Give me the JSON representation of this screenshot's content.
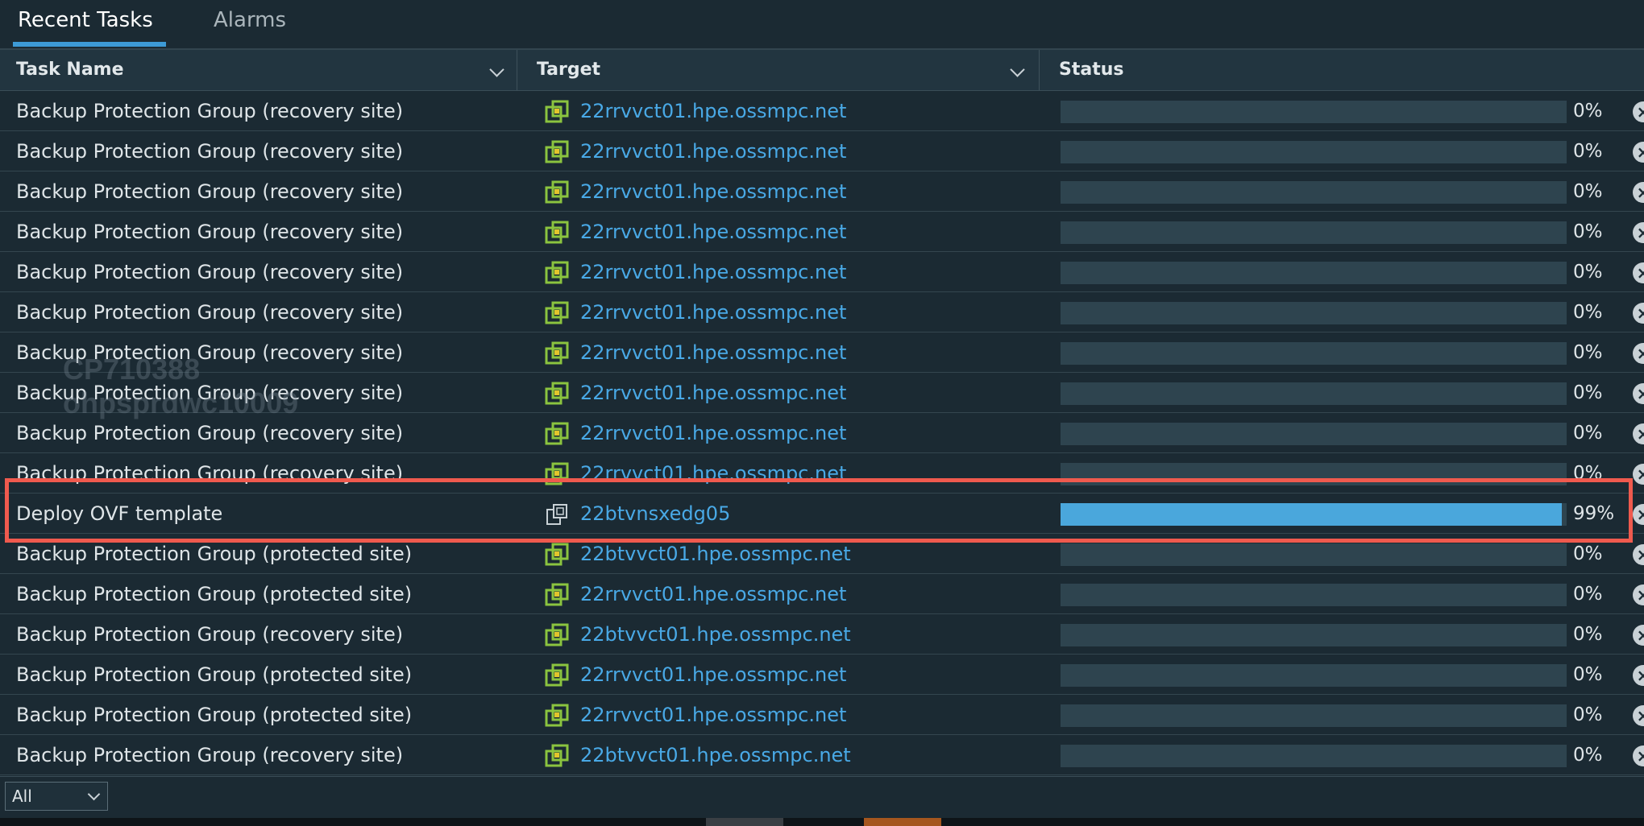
{
  "tabs": [
    {
      "label": "Recent Tasks",
      "active": true
    },
    {
      "label": "Alarms",
      "active": false
    }
  ],
  "columns": {
    "task": "Task Name",
    "target": "Target",
    "status": "Status"
  },
  "rows": [
    {
      "task": "Backup Protection Group (recovery site)",
      "target": "22rrvvct01.hpe.ossmpc.net",
      "icon": "vcenter-icon",
      "progress": 0,
      "percent": "0%"
    },
    {
      "task": "Backup Protection Group (recovery site)",
      "target": "22rrvvct01.hpe.ossmpc.net",
      "icon": "vcenter-icon",
      "progress": 0,
      "percent": "0%"
    },
    {
      "task": "Backup Protection Group (recovery site)",
      "target": "22rrvvct01.hpe.ossmpc.net",
      "icon": "vcenter-icon",
      "progress": 0,
      "percent": "0%"
    },
    {
      "task": "Backup Protection Group (recovery site)",
      "target": "22rrvvct01.hpe.ossmpc.net",
      "icon": "vcenter-icon",
      "progress": 0,
      "percent": "0%"
    },
    {
      "task": "Backup Protection Group (recovery site)",
      "target": "22rrvvct01.hpe.ossmpc.net",
      "icon": "vcenter-icon",
      "progress": 0,
      "percent": "0%"
    },
    {
      "task": "Backup Protection Group (recovery site)",
      "target": "22rrvvct01.hpe.ossmpc.net",
      "icon": "vcenter-icon",
      "progress": 0,
      "percent": "0%"
    },
    {
      "task": "Backup Protection Group (recovery site)",
      "target": "22rrvvct01.hpe.ossmpc.net",
      "icon": "vcenter-icon",
      "progress": 0,
      "percent": "0%"
    },
    {
      "task": "Backup Protection Group (recovery site)",
      "target": "22rrvvct01.hpe.ossmpc.net",
      "icon": "vcenter-icon",
      "progress": 0,
      "percent": "0%"
    },
    {
      "task": "Backup Protection Group (recovery site)",
      "target": "22rrvvct01.hpe.ossmpc.net",
      "icon": "vcenter-icon",
      "progress": 0,
      "percent": "0%"
    },
    {
      "task": "Backup Protection Group (recovery site)",
      "target": "22rrvvct01.hpe.ossmpc.net",
      "icon": "vcenter-icon",
      "progress": 0,
      "percent": "0%"
    },
    {
      "task": "Deploy OVF template",
      "target": "22btvnsxedg05",
      "icon": "vm-icon",
      "progress": 0.99,
      "percent": "99%"
    },
    {
      "task": "Backup Protection Group (protected site)",
      "target": "22btvvct01.hpe.ossmpc.net",
      "icon": "vcenter-icon",
      "progress": 0,
      "percent": "0%"
    },
    {
      "task": "Backup Protection Group (protected site)",
      "target": "22rrvvct01.hpe.ossmpc.net",
      "icon": "vcenter-icon",
      "progress": 0,
      "percent": "0%"
    },
    {
      "task": "Backup Protection Group (recovery site)",
      "target": "22btvvct01.hpe.ossmpc.net",
      "icon": "vcenter-icon",
      "progress": 0,
      "percent": "0%"
    },
    {
      "task": "Backup Protection Group (protected site)",
      "target": "22rrvvct01.hpe.ossmpc.net",
      "icon": "vcenter-icon",
      "progress": 0,
      "percent": "0%"
    },
    {
      "task": "Backup Protection Group (protected site)",
      "target": "22rrvvct01.hpe.ossmpc.net",
      "icon": "vcenter-icon",
      "progress": 0,
      "percent": "0%"
    },
    {
      "task": "Backup Protection Group (recovery site)",
      "target": "22btvvct01.hpe.ossmpc.net",
      "icon": "vcenter-icon",
      "progress": 0,
      "percent": "0%"
    }
  ],
  "watermark": [
    "CP710388",
    "ohpsprdwc10009"
  ],
  "footer": {
    "filter_value": "All"
  },
  "colors": {
    "background": "#1b2a33",
    "link": "#49a9e6",
    "progress_fill": "#4aa7dc",
    "progress_track": "#2e444f",
    "highlight": "#ef5a4e",
    "vcenter_icon": "#8bc43f"
  }
}
